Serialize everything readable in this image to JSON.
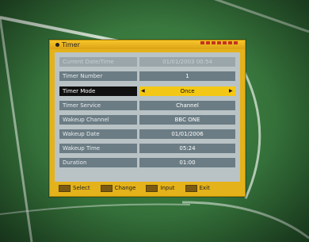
{
  "window": {
    "title": "Timer"
  },
  "rows": [
    {
      "label": "Current Date/Time",
      "value": "01/01/2003   00:54",
      "state": "dim"
    },
    {
      "label": "Timer Number",
      "value": "1",
      "state": "normal"
    },
    {
      "label": "Timer Mode",
      "value": "Once",
      "state": "selected"
    },
    {
      "label": "Timer Service",
      "value": "Channel",
      "state": "normal"
    },
    {
      "label": "Wakeup Channel",
      "value": "BBC ONE",
      "state": "normal"
    },
    {
      "label": "Wakeup Date",
      "value": "01/01/2006",
      "state": "normal"
    },
    {
      "label": "Wakeup Time",
      "value": "05:24",
      "state": "normal"
    },
    {
      "label": "Duration",
      "value": "01:00",
      "state": "normal"
    }
  ],
  "hints": [
    {
      "key_icon": "select-key",
      "label": "Select"
    },
    {
      "key_icon": "change-key",
      "label": "Change"
    },
    {
      "key_icon": "input-key",
      "label": "Input"
    },
    {
      "key_icon": "exit-key",
      "label": "Exit"
    }
  ],
  "colors": {
    "window": "#e4b21a",
    "panel": "#b9c3c6",
    "row": "#6b7c84",
    "selected_value": "#f3c715"
  }
}
